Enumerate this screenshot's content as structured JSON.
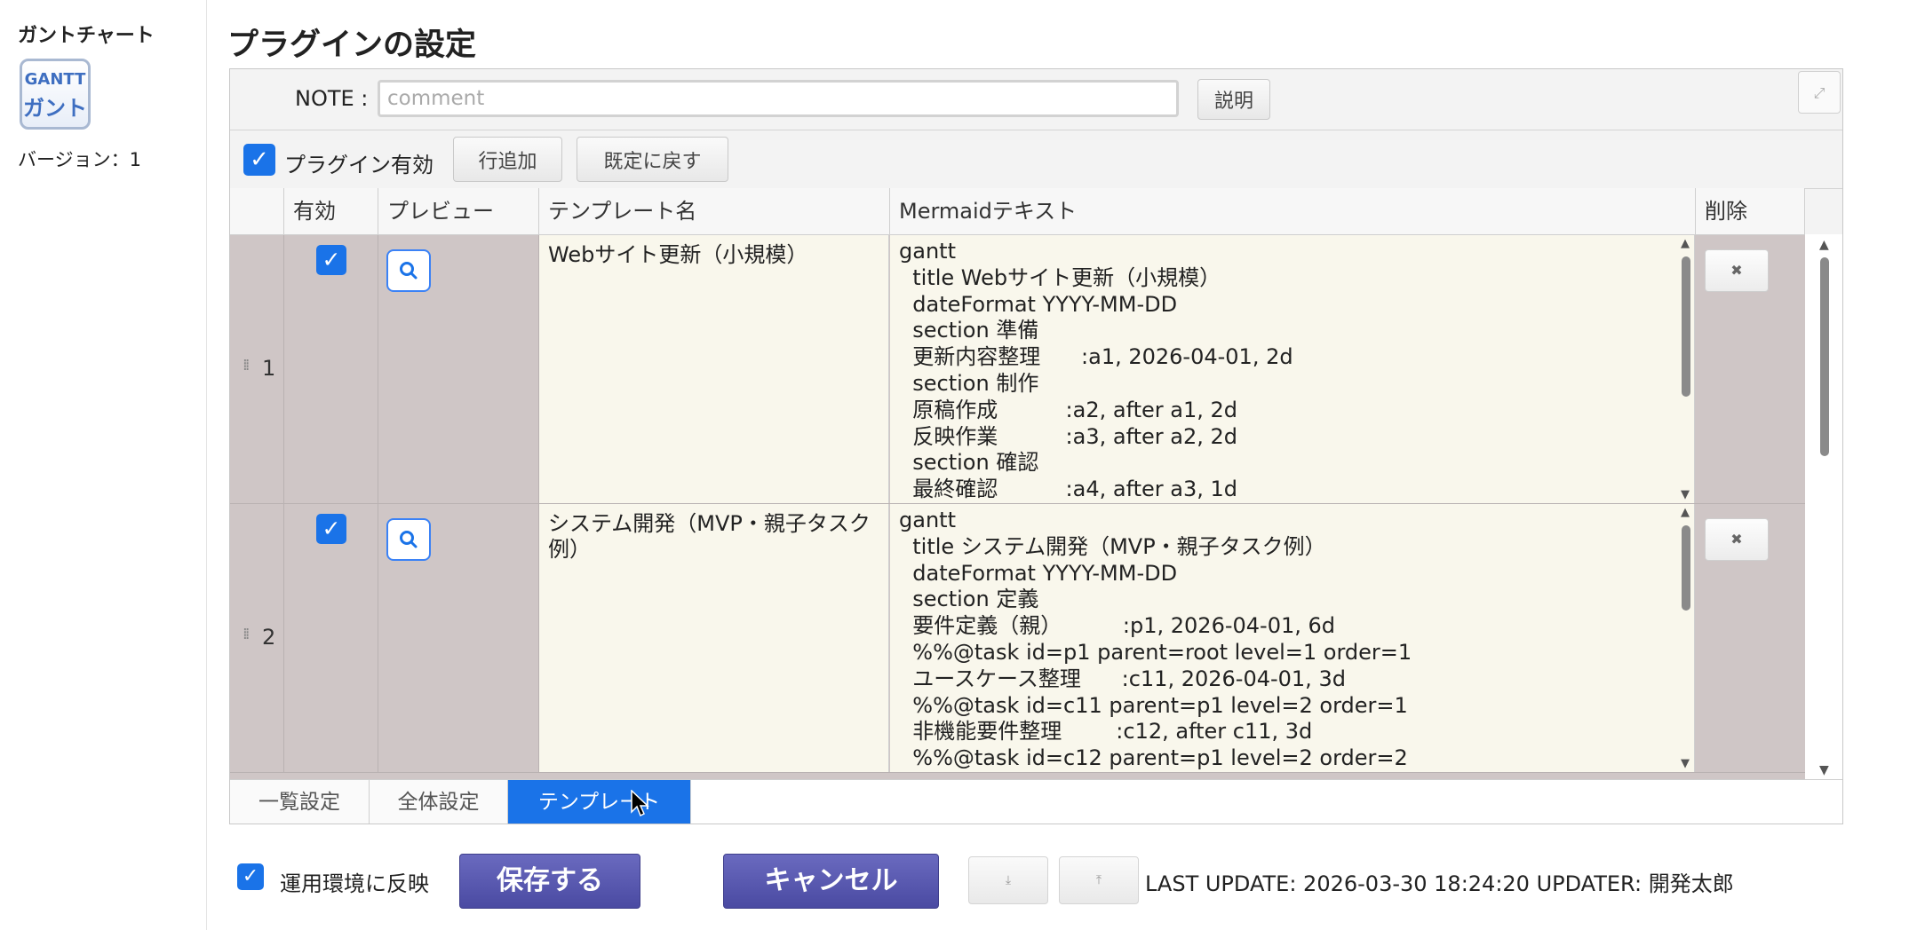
{
  "sidebar": {
    "title": "ガントチャート",
    "icon_line1": "GANTT",
    "icon_line2": "ガント",
    "version": "バージョン：1"
  },
  "page": {
    "title": "プラグインの設定"
  },
  "note": {
    "label": "NOTE :",
    "placeholder": "comment",
    "value": "",
    "help_button": "説明"
  },
  "toolbar": {
    "enable_label": "プラグイン有効",
    "add_row": "行追加",
    "reset": "既定に戻す"
  },
  "grid": {
    "headers": {
      "enabled": "有効",
      "preview": "プレビュー",
      "name": "テンプレート名",
      "text": "Mermaidテキスト",
      "delete": "削除"
    },
    "rows": [
      {
        "no": "1",
        "enabled": true,
        "name": "Webサイト更新（小規模）",
        "text": "gantt\n  title Webサイト更新（小規模）\n  dateFormat YYYY-MM-DD\n  section 準備\n  更新内容整理      :a1, 2026-04-01, 2d\n  section 制作\n  原稿作成          :a2, after a1, 2d\n  反映作業          :a3, after a2, 2d\n  section 確認\n  最終確認          :a4, after a3, 1d"
      },
      {
        "no": "2",
        "enabled": true,
        "name": "システム開発（MVP・親子タスク例）",
        "text": "gantt\n  title システム開発（MVP・親子タスク例）\n  dateFormat YYYY-MM-DD\n  section 定義\n  要件定義（親）         :p1, 2026-04-01, 6d\n  %%@task id=p1 parent=root level=1 order=1\n  ユースケース整理      :c11, 2026-04-01, 3d\n  %%@task id=c11 parent=p1 level=2 order=1\n  非機能要件整理        :c12, after c11, 3d\n  %%@task id=c12 parent=p1 level=2 order=2"
      }
    ]
  },
  "tabs": [
    {
      "label": "一覧設定",
      "active": false
    },
    {
      "label": "全体設定",
      "active": false
    },
    {
      "label": "テンプレート",
      "active": true
    }
  ],
  "footer": {
    "deploy_label": "運用環境に反映",
    "save": "保存する",
    "cancel": "キャンセル",
    "last_update": "LAST UPDATE: 2026-03-30 18:24:20 UPDATER: 開発太郎"
  }
}
